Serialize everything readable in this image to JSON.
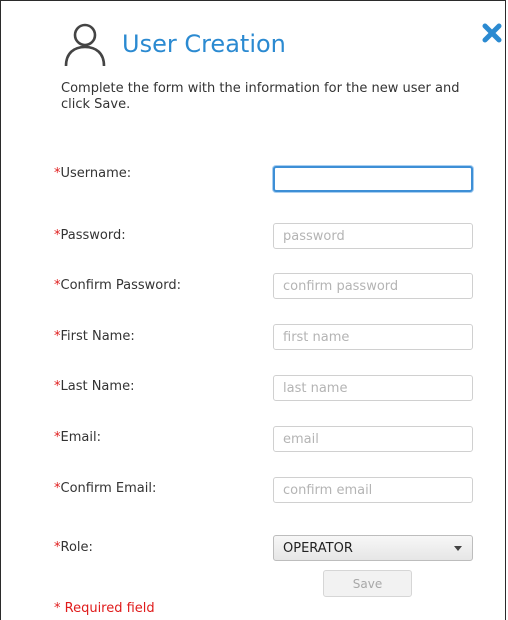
{
  "dialog": {
    "title": "User Creation",
    "user_icon": "user-outline-icon",
    "close_icon": "close-x-icon",
    "intro": "Complete the form with the information for the new user and click Save.",
    "accent_color": "#2b8ad1",
    "required_color": "#e01b1b"
  },
  "fields": {
    "username": {
      "marker": "*",
      "label": "Username:",
      "value": "",
      "placeholder": ""
    },
    "password": {
      "marker": "*",
      "label": "Password:",
      "value": "",
      "placeholder": "password"
    },
    "confirm_password": {
      "marker": "*",
      "label": "Confirm Password:",
      "value": "",
      "placeholder": "confirm password"
    },
    "first_name": {
      "marker": "*",
      "label": "First Name:",
      "value": "",
      "placeholder": "first name"
    },
    "last_name": {
      "marker": "*",
      "label": "Last Name:",
      "value": "",
      "placeholder": "last name"
    },
    "email": {
      "marker": "*",
      "label": "Email:",
      "value": "",
      "placeholder": "email"
    },
    "confirm_email": {
      "marker": "*",
      "label": "Confirm Email:",
      "value": "",
      "placeholder": "confirm email"
    },
    "role": {
      "marker": "*",
      "label": "Role:",
      "selected": "OPERATOR"
    }
  },
  "footer": {
    "required_note": "* Required field",
    "save_label": "Save"
  }
}
